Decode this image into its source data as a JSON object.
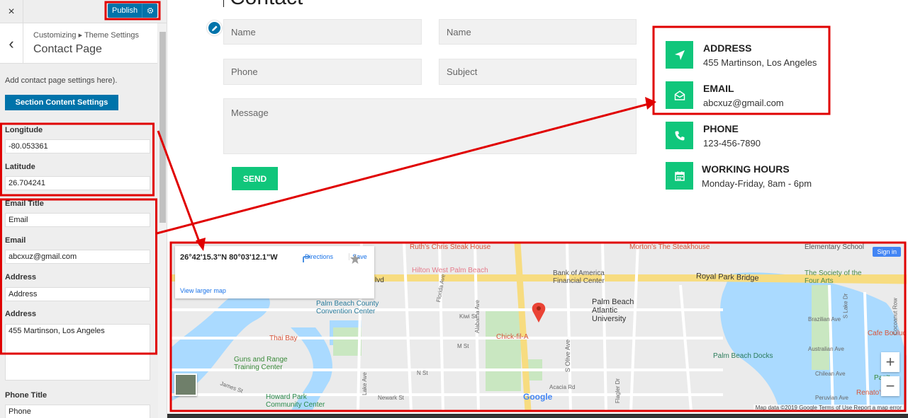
{
  "sidebar": {
    "close_icon": "×",
    "publish_label": "Publish",
    "back_icon": "‹",
    "breadcrumb": "Customizing ▸ Theme Settings",
    "title": "Contact Page",
    "description": "Add contact page settings here).",
    "section_button": "Section Content Settings",
    "fields": {
      "longitude_label": "Longitude",
      "longitude_value": "-80.053361",
      "latitude_label": "Latitude",
      "latitude_value": "26.704241",
      "email_title_label": "Email Title",
      "email_title_value": "Email",
      "email_label": "Email",
      "email_value": "abcxuz@gmail.com",
      "address_title_label": "Address",
      "address_title_value": "Address",
      "address_label": "Address",
      "address_value": "455 Martinson, Los Angeles",
      "phone_title_label": "Phone Title",
      "phone_title_value": "Phone"
    }
  },
  "page": {
    "heading": "Contact",
    "form": {
      "name_placeholder_1": "Name",
      "name_placeholder_2": "Name",
      "phone_placeholder": "Phone",
      "subject_placeholder": "Subject",
      "message_placeholder": "Message",
      "send_label": "SEND"
    },
    "info": [
      {
        "title": "ADDRESS",
        "value": "455 Martinson, Los Angeles",
        "icon": "location-arrow-icon"
      },
      {
        "title": "EMAIL",
        "value": "abcxuz@gmail.com",
        "icon": "envelope-open-icon"
      },
      {
        "title": "PHONE",
        "value": "123-456-7890",
        "icon": "phone-icon"
      },
      {
        "title": "WORKING HOURS",
        "value": "Monday-Friday, 8am - 6pm",
        "icon": "calendar-icon"
      }
    ]
  },
  "map": {
    "coords": "26°42'15.3\"N 80°03'12.1\"W",
    "directions": "Directions",
    "save": "Save",
    "larger_map": "View larger map",
    "sign_in": "Sign in",
    "footer": "Map data ©2019 Google   Terms of Use   Report a map error",
    "google": "Google",
    "labels": {
      "ruths": "Ruth's Chris Steak House",
      "hilton": "Hilton West Palm Beach",
      "bofa": "Bank of America Financial Center",
      "mortons": "Morton's The Steakhouse",
      "royal": "Royal Park Bridge",
      "elementary": "Elementary School",
      "four_arts": "The Society of the Four Arts",
      "convention": "Palm Beach County Convention Center",
      "atlantic": "Palm Beach Atlantic University",
      "thai": "Thai Bay",
      "chick": "Chick-fil-A",
      "guns": "Guns and Range Training Center",
      "howard": "Howard Park Community Center",
      "docks": "Palm Beach Docks",
      "cafe": "Cafe Boulud",
      "renatos": "Renato's",
      "pan": "Pan't",
      "blvd": "lvd",
      "brazilian": "Brazilian Ave",
      "australian": "Australian Ave",
      "chilean": "Chilean Ave",
      "peruvian": "Peruvian Ave",
      "kiwi": "Kiwi St",
      "n_st": "N St",
      "m_st": "M St",
      "james": "James St",
      "newark": "Newark St",
      "acacia": "Acacia Rd",
      "olive": "S Olive Ave",
      "flagler": "Flagler Dr",
      "alabama": "Alabama Ave",
      "florida": "Florida Ave",
      "lake_ave": "Lake Ave",
      "lake_dr": "S Lake Dr",
      "cocoanut": "Cocoanut Row"
    }
  }
}
